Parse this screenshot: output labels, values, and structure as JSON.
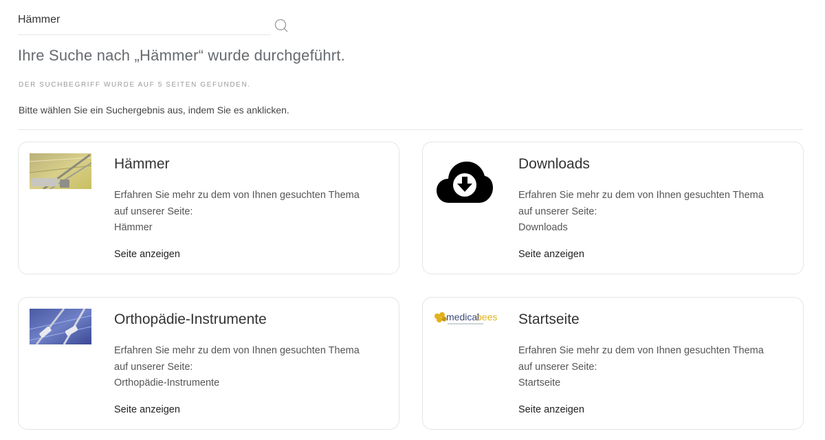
{
  "search": {
    "value": "Hämmer",
    "heading": "Ihre Suche nach „Hämmer“ wurde durchgeführt.",
    "subline": "DER SUCHBEGRIFF WURDE AUF 5 SEITEN GEFUNDEN.",
    "instruction": "Bitte wählen Sie ein Suchergebnis aus, indem Sie es anklicken."
  },
  "results": [
    {
      "title": "Hämmer",
      "text_line1": "Erfahren Sie mehr zu dem von Ihnen gesuchten Thema",
      "text_line2": "auf unserer Seite:",
      "page": "Hämmer",
      "link": "Seite anzeigen",
      "thumbnail": "hammer-photo"
    },
    {
      "title": "Downloads",
      "text_line1": "Erfahren Sie mehr zu dem von Ihnen gesuchten Thema",
      "text_line2": "auf unserer Seite:",
      "page": "Downloads",
      "link": "Seite anzeigen",
      "thumbnail": "cloud-download-icon"
    },
    {
      "title": "Orthopädie-Instrumente",
      "text_line1": "Erfahren Sie mehr zu dem von Ihnen gesuchten Thema",
      "text_line2": "auf unserer Seite:",
      "page": "Orthopädie-Instrumente",
      "link": "Seite anzeigen",
      "thumbnail": "instruments-photo"
    },
    {
      "title": "Startseite",
      "text_line1": "Erfahren Sie mehr zu dem von Ihnen gesuchten Thema",
      "text_line2": "auf unserer Seite:",
      "page": "Startseite",
      "link": "Seite anzeigen",
      "thumbnail": "medicalbees-logo",
      "logo_text_1": "medical",
      "logo_text_2": "bees"
    }
  ],
  "colors": {
    "heading": "#666a6e",
    "border": "#e4e4e4",
    "logo_gold": "#e2b21a"
  }
}
